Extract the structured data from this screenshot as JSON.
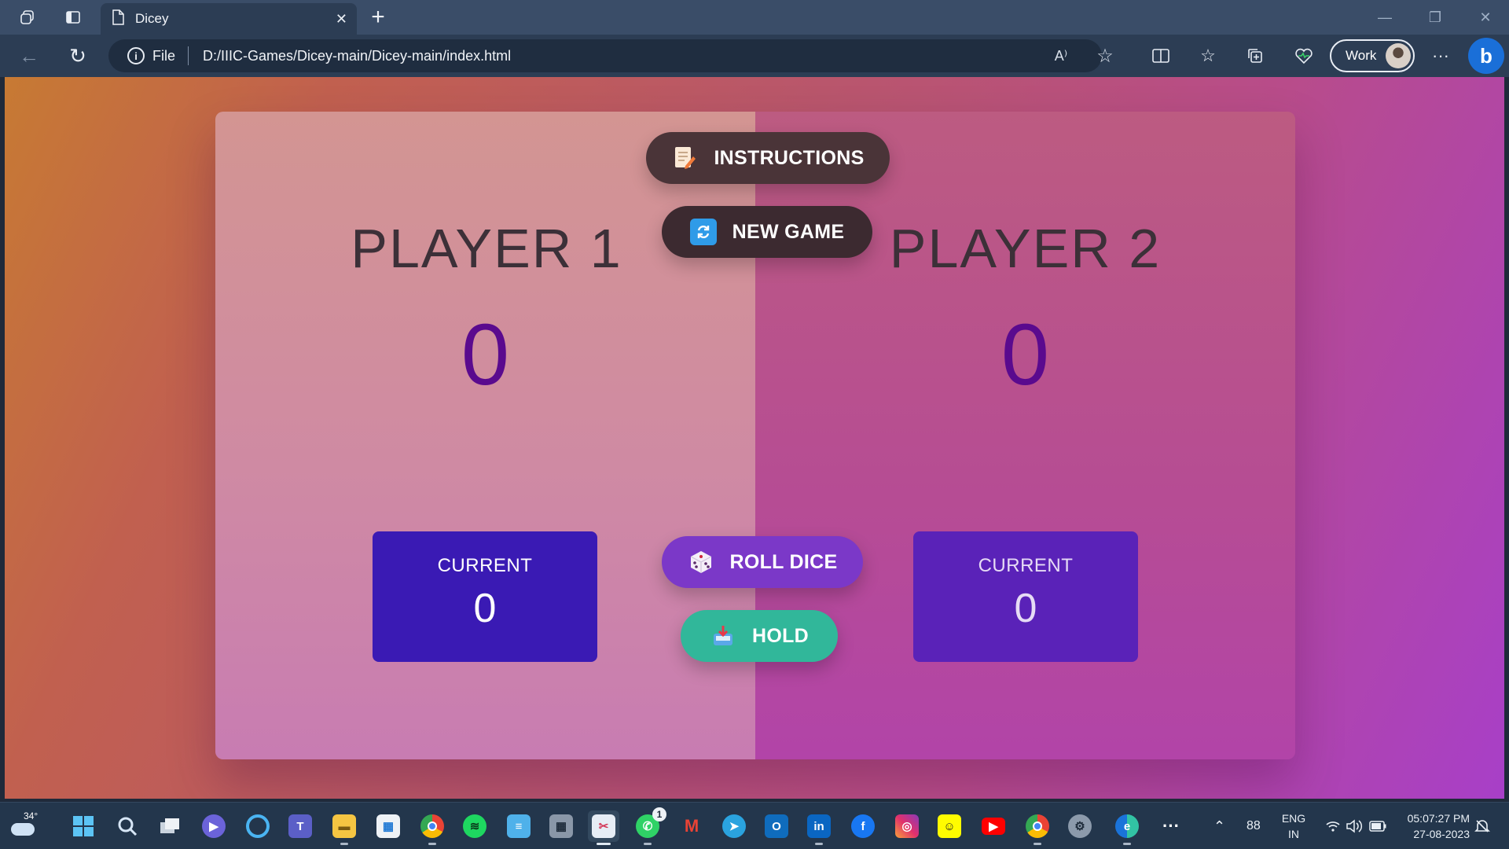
{
  "browser": {
    "tab_title": "Dicey",
    "address_prefix": "File",
    "url": "D:/IIIC-Games/Dicey-main/Dicey-main/index.html",
    "profile_label": "Work",
    "read_aloud_glyph": "A⁾"
  },
  "game": {
    "player1": {
      "name": "PLAYER 1",
      "score": "0",
      "current_label": "CURRENT",
      "current_score": "0"
    },
    "player2": {
      "name": "PLAYER 2",
      "score": "0",
      "current_label": "CURRENT",
      "current_score": "0"
    },
    "buttons": {
      "instructions": "INSTRUCTIONS",
      "new_game": "NEW GAME",
      "roll_dice": "ROLL DICE",
      "hold": "HOLD"
    }
  },
  "taskbar": {
    "weather_temp": "34°",
    "whatsapp_badge": "1",
    "tray_number": "88",
    "lang_top": "ENG",
    "lang_bottom": "IN",
    "time": "05:07:27 PM",
    "date": "27-08-2023"
  },
  "colors": {
    "player1_current_bg": "#3a1ab4",
    "player2_current_bg": "#5a22b8",
    "score_color": "#5a0a8e",
    "roll_button": "#7b38c8",
    "hold_button": "#31b79a"
  }
}
